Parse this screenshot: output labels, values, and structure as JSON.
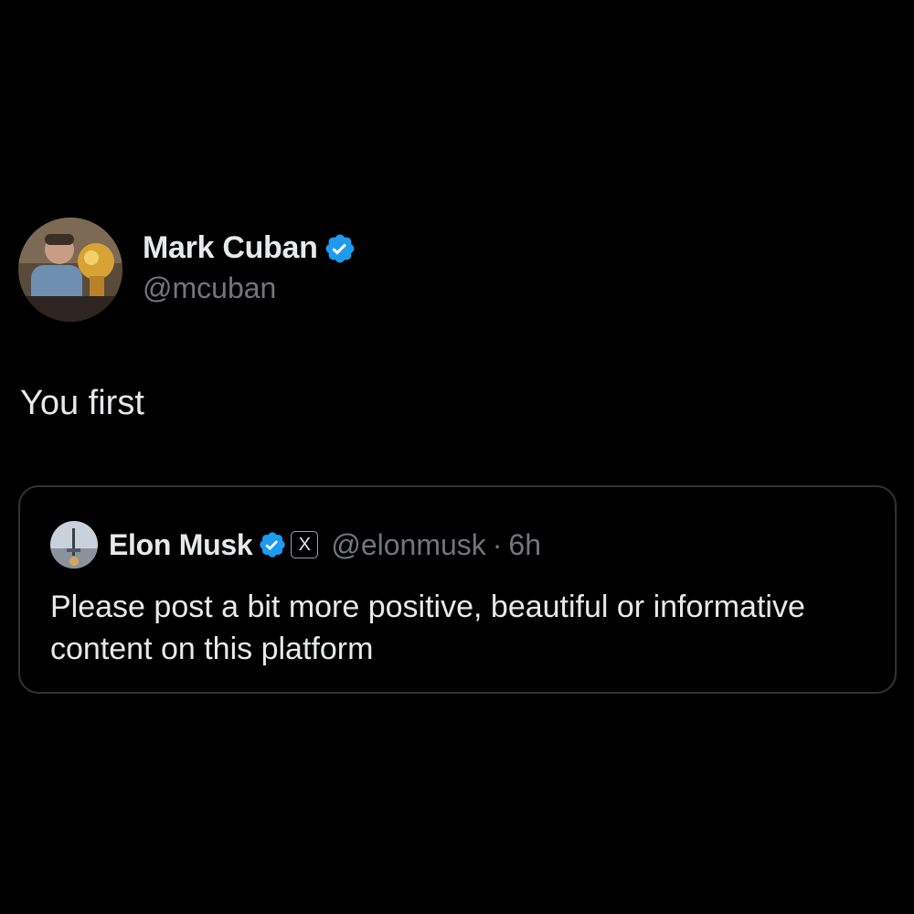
{
  "post": {
    "author": {
      "display_name": "Mark Cuban",
      "handle": "@mcuban",
      "verified_icon": "verified-badge-icon"
    },
    "text": "You first"
  },
  "quoted_post": {
    "author": {
      "display_name": "Elon Musk",
      "handle": "@elonmusk",
      "verified_icon": "verified-badge-icon",
      "affiliation_badge": "X"
    },
    "separator": "·",
    "time": "6h",
    "text": "Please post a bit more positive, beautiful or informative content on this platform"
  },
  "colors": {
    "background": "#000000",
    "primary_text": "#e7e9ea",
    "secondary_text": "#71767b",
    "verified_blue": "#1d9bf0",
    "border": "#2f3336"
  }
}
